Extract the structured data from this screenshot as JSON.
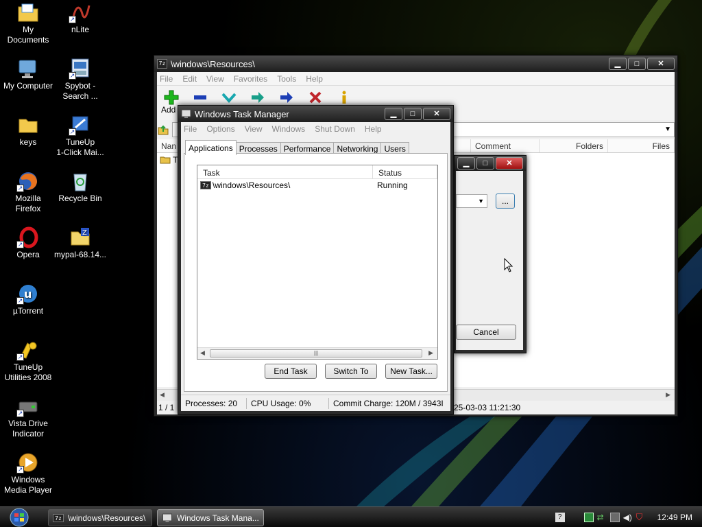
{
  "desktop_icons": [
    {
      "label": "My\nDocuments",
      "icon": "folder-documents-icon"
    },
    {
      "label": "nLite",
      "icon": "nlite-icon"
    },
    {
      "label": "My Computer",
      "icon": "computer-icon"
    },
    {
      "label": "Spybot -\nSearch ...",
      "icon": "spybot-icon"
    },
    {
      "label": "keys",
      "icon": "folder-icon"
    },
    {
      "label": "TuneUp\n1-Click Mai...",
      "icon": "tuneup-icon"
    },
    {
      "label": "Mozilla\nFirefox",
      "icon": "firefox-icon"
    },
    {
      "label": "Recycle Bin",
      "icon": "recycle-bin-icon"
    },
    {
      "label": "Opera",
      "icon": "opera-icon"
    },
    {
      "label": "mypal-68.14...",
      "icon": "zip-folder-icon"
    },
    {
      "label": "µTorrent",
      "icon": "utorrent-icon"
    },
    {
      "label": "TuneUp\nUtilities 2008",
      "icon": "tuneup-utilities-icon"
    },
    {
      "label": "Vista Drive\nIndicator",
      "icon": "drive-indicator-icon"
    },
    {
      "label": "Windows\nMedia Player",
      "icon": "media-player-icon"
    }
  ],
  "zip_window": {
    "title": "\\windows\\Resources\\",
    "menu": [
      "File",
      "Edit",
      "View",
      "Favorites",
      "Tools",
      "Help"
    ],
    "toolbar_first_label": "Add",
    "columns": [
      "Nan",
      "Comment",
      "Folders",
      "Files"
    ],
    "list_item_partial": "T",
    "status_left": "1 / 1",
    "status_right": "25-03-03 11:21:30"
  },
  "dialog": {
    "browse_label": "...",
    "cancel_label": "Cancel"
  },
  "task_manager": {
    "title": "Windows Task Manager",
    "menu": [
      "File",
      "Options",
      "View",
      "Windows",
      "Shut Down",
      "Help"
    ],
    "tabs": [
      "Applications",
      "Processes",
      "Performance",
      "Networking",
      "Users"
    ],
    "active_tab": "Applications",
    "columns": {
      "task": "Task",
      "status": "Status"
    },
    "tasks": [
      {
        "name": "\\windows\\Resources\\",
        "status": "Running"
      }
    ],
    "scroll_grip": "|||",
    "buttons": {
      "end_task": "End Task",
      "switch_to": "Switch To",
      "new_task": "New Task..."
    },
    "status_bar": {
      "processes": "Processes: 20",
      "cpu": "CPU Usage: 0%",
      "commit": "Commit Charge: 120M / 3943I"
    }
  },
  "taskbar": {
    "tasks": [
      {
        "label": "\\windows\\Resources\\",
        "active": false
      },
      {
        "label": "Windows Task Mana...",
        "active": true
      }
    ],
    "clock": "12:49 PM"
  },
  "colors": {
    "desktop_bg": "#000000",
    "titlebar": "#2b2b2b",
    "close_red": "#c0262c",
    "add_green": "#1db61d",
    "remove_blue": "#1d3fb6"
  }
}
